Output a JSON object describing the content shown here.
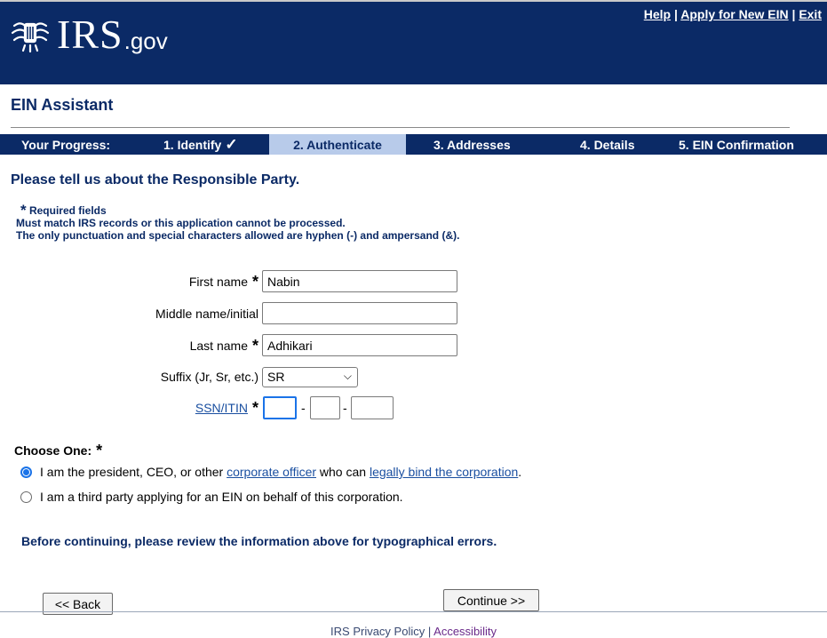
{
  "header": {
    "logo_text": "IRS",
    "logo_suffix": ".gov",
    "links": {
      "help": "Help",
      "apply": "Apply for New EIN",
      "exit": "Exit",
      "separator": "|"
    }
  },
  "app_title": "EIN Assistant",
  "progress": {
    "label": "Your Progress:",
    "steps": [
      "1. Identify",
      "2. Authenticate",
      "3. Addresses",
      "4. Details",
      "5. EIN Confirmation"
    ],
    "current_step": 2,
    "completed_icon": "checkmark-icon"
  },
  "heading": "Please tell us about the Responsible Party.",
  "notes": {
    "required_star": "*",
    "required": "Required fields",
    "match": "Must match IRS records or this application cannot be processed.",
    "punctuation": "The only punctuation and special characters allowed are hyphen (-) and ampersand (&)."
  },
  "form": {
    "first_name": {
      "label": "First name",
      "value": "Nabin",
      "required": "*"
    },
    "middle_name": {
      "label": "Middle name/initial",
      "value": ""
    },
    "last_name": {
      "label": "Last name",
      "value": "Adhikari",
      "required": "*"
    },
    "suffix": {
      "label": "Suffix (Jr, Sr, etc.)",
      "value": "SR"
    },
    "ssn": {
      "label": "SSN/ITIN",
      "required": "*",
      "part1": "",
      "part2": "",
      "part3": "",
      "dash": "-"
    }
  },
  "choose": {
    "label": "Choose One:",
    "required": "*",
    "option1": {
      "pre": "I am the president, CEO, or other ",
      "link1": "corporate officer",
      "mid": " who can ",
      "link2": "legally bind the corporation",
      "post": ".",
      "selected": true
    },
    "option2": {
      "text": "I am a third party applying for an EIN on behalf of this corporation.",
      "selected": false
    }
  },
  "review_note": "Before continuing, please review the information above for typographical errors.",
  "buttons": {
    "back": "<< Back",
    "continue": "Continue >>"
  },
  "footer": {
    "privacy": "IRS Privacy Policy",
    "separator": "|",
    "accessibility": "Accessibility"
  },
  "colors": {
    "navy": "#0b2a66",
    "active_step_bg": "#b8cbea",
    "link": "#1a4fa0",
    "radio_selected": "#1a73e8"
  }
}
